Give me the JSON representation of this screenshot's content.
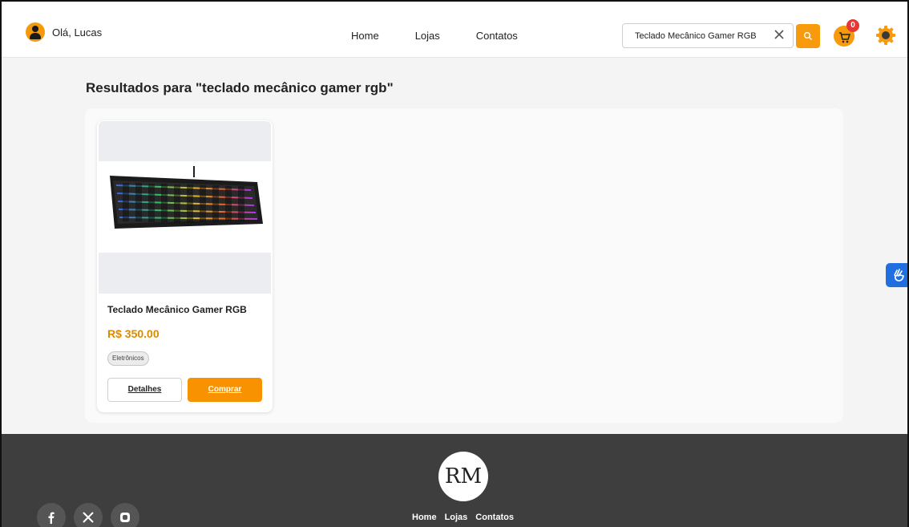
{
  "header": {
    "greeting": "Olá, Lucas",
    "nav": [
      "Home",
      "Lojas",
      "Contatos"
    ],
    "search_value": "Teclado Mecânico Gamer RGB",
    "cart_count": "0"
  },
  "main": {
    "results_title": "Resultados para \"teclado mecânico gamer rgb\"",
    "product": {
      "title": "Teclado Mecânico Gamer RGB",
      "price": "R$ 350.00",
      "category": "Eletrônicos",
      "details_label": "Detalhes",
      "buy_label": "Comprar"
    }
  },
  "footer": {
    "logo_text": "RM",
    "nav": [
      "Home",
      "Lojas",
      "Contatos"
    ],
    "social_icons": [
      "facebook-icon",
      "x-icon",
      "instagram-icon"
    ]
  },
  "colors": {
    "accent": "#f79a0c",
    "price": "#dc8a00",
    "footer_bg": "#3e3e3e",
    "a11y": "#1f6fe0"
  }
}
